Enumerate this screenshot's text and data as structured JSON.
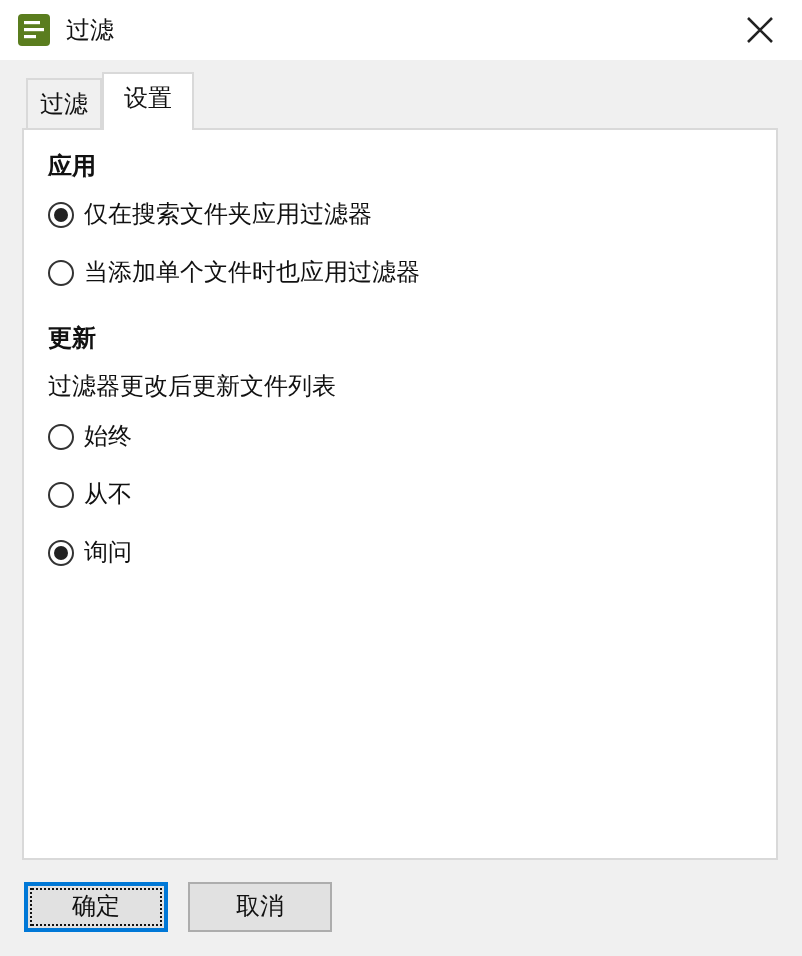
{
  "window": {
    "title": "过滤"
  },
  "tabs": [
    {
      "label": "过滤",
      "selected": false
    },
    {
      "label": "设置",
      "selected": true
    }
  ],
  "sections": [
    {
      "title": "应用",
      "options": [
        {
          "label": "仅在搜索文件夹应用过滤器",
          "selected": true
        },
        {
          "label": "当添加单个文件时也应用过滤器",
          "selected": false
        }
      ]
    },
    {
      "title": "更新",
      "description": "过滤器更改后更新文件列表",
      "options": [
        {
          "label": "始终",
          "selected": false
        },
        {
          "label": "从不",
          "selected": false
        },
        {
          "label": "询问",
          "selected": true
        }
      ]
    }
  ],
  "buttons": [
    {
      "label": "确定",
      "focused": true
    },
    {
      "label": "取消",
      "focused": false
    }
  ]
}
